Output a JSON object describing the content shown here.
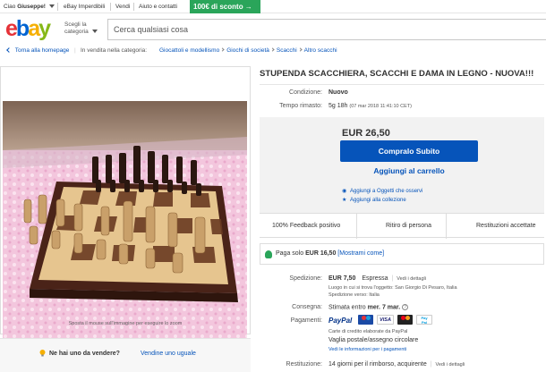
{
  "topbar": {
    "greeting": "Ciao",
    "user": "Giuseppe!",
    "links": [
      "eBay Imperdibili",
      "Vendi",
      "Aiuto e contatti"
    ],
    "promo": "100€ di sconto →"
  },
  "header": {
    "logo_letters": [
      "e",
      "b",
      "a",
      "y"
    ],
    "category_label": "Scegli la categoria",
    "search_placeholder": "Cerca qualsiasi cosa"
  },
  "breadcrumb": {
    "back": "Torna alla homepage",
    "listed_in": "In vendita nella categoria:",
    "path": [
      "Giocattoli e modellismo",
      "Giochi di società",
      "Scacchi",
      "Altro scacchi"
    ]
  },
  "gallery": {
    "hint": "Sposta il mouse sull'immagine per eseguire lo zoom"
  },
  "sell_promo": {
    "question": "Ne hai uno da vendere?",
    "link": "Vendine uno uguale"
  },
  "listing": {
    "title": "STUPENDA SCACCHIERA, SCACCHI E DAMA IN LEGNO - NUOVA!!!",
    "condition_label": "Condizione:",
    "condition": "Nuovo",
    "time_label": "Tempo rimasto:",
    "time_left": "5g 18h",
    "time_detail": "(07 mar 2018  11:41:10 CET)"
  },
  "buybox": {
    "price": "EUR 26,50",
    "buy_now": "Compralo Subito",
    "add_cart": "Aggiungi al carrello",
    "watch": "Aggiungi a Oggetti che osservi",
    "collection": "Aggiungi alla collezione"
  },
  "features": [
    "100% Feedback positivo",
    "Ritiro di persona",
    "Restituzioni accettate"
  ],
  "paypal_note": {
    "prefix": "Paga solo",
    "amount": "EUR 16,50",
    "link": "[Mostrami come]"
  },
  "shipping": {
    "label": "Spedizione:",
    "price": "EUR 7,50",
    "method": "Espressa",
    "details": "Vedi i dettagli",
    "location": "Luogo in cui si trova l'oggetto: San Giorgio Di Pesaro, Italia",
    "ships_to": "Spedizione verso:  Italia"
  },
  "delivery": {
    "label": "Consegna:",
    "prefix": "Stimata entro",
    "date": "mer. 7 mar."
  },
  "payments": {
    "label": "Pagamenti:",
    "methods": [
      "PayPal",
      "Maestro",
      "VISA",
      "MasterCard",
      "PayPal Credit"
    ],
    "card_note": "Carte di credito elaborate da PayPal",
    "alt": "Vaglia postale/assegno circolare",
    "more": "Vedi le informazioni per i pagamenti"
  },
  "returns": {
    "label": "Restituzione:",
    "text": "14 giorni per il rimborso, acquirente",
    "details": "Vedi i dettagli"
  },
  "colors": {
    "ebay_red": "#e53238",
    "ebay_blue": "#0064d2",
    "ebay_yellow": "#f5af02",
    "ebay_green": "#86b817",
    "button_blue": "#0654ba",
    "promo_green": "#2aa55a"
  }
}
